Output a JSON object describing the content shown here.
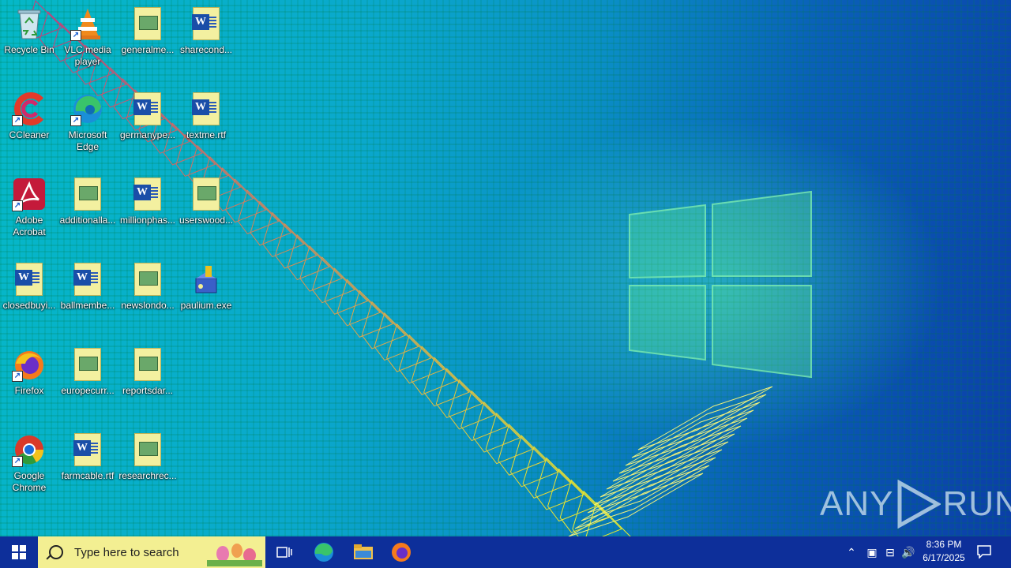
{
  "desktop_icons": [
    {
      "label": "Recycle Bin"
    },
    {
      "label": "VLC media player"
    },
    {
      "label": "generalme..."
    },
    {
      "label": "sharecond..."
    },
    {
      "label": "CCleaner"
    },
    {
      "label": "Microsoft Edge"
    },
    {
      "label": "germanype..."
    },
    {
      "label": "textme.rtf"
    },
    {
      "label": "Adobe Acrobat"
    },
    {
      "label": "additionalla..."
    },
    {
      "label": "millionphas..."
    },
    {
      "label": "userswood..."
    },
    {
      "label": "closedbuyi..."
    },
    {
      "label": "ballmembe..."
    },
    {
      "label": "newslondo..."
    },
    {
      "label": "paulium.exe"
    },
    {
      "label": "Firefox"
    },
    {
      "label": "europecurr..."
    },
    {
      "label": "reportsdar..."
    },
    {
      "label": "Google Chrome"
    },
    {
      "label": "farmcable.rtf"
    },
    {
      "label": "researchrec..."
    }
  ],
  "taskbar": {
    "search_placeholder": "Type here to search",
    "clock_time": "8:36 PM",
    "clock_date": "6/17/2025"
  },
  "watermark": {
    "left": "ANY",
    "right": "RUN"
  },
  "colors": {
    "taskbar": "#0d2f9a",
    "search_box": "#f3ef92"
  }
}
